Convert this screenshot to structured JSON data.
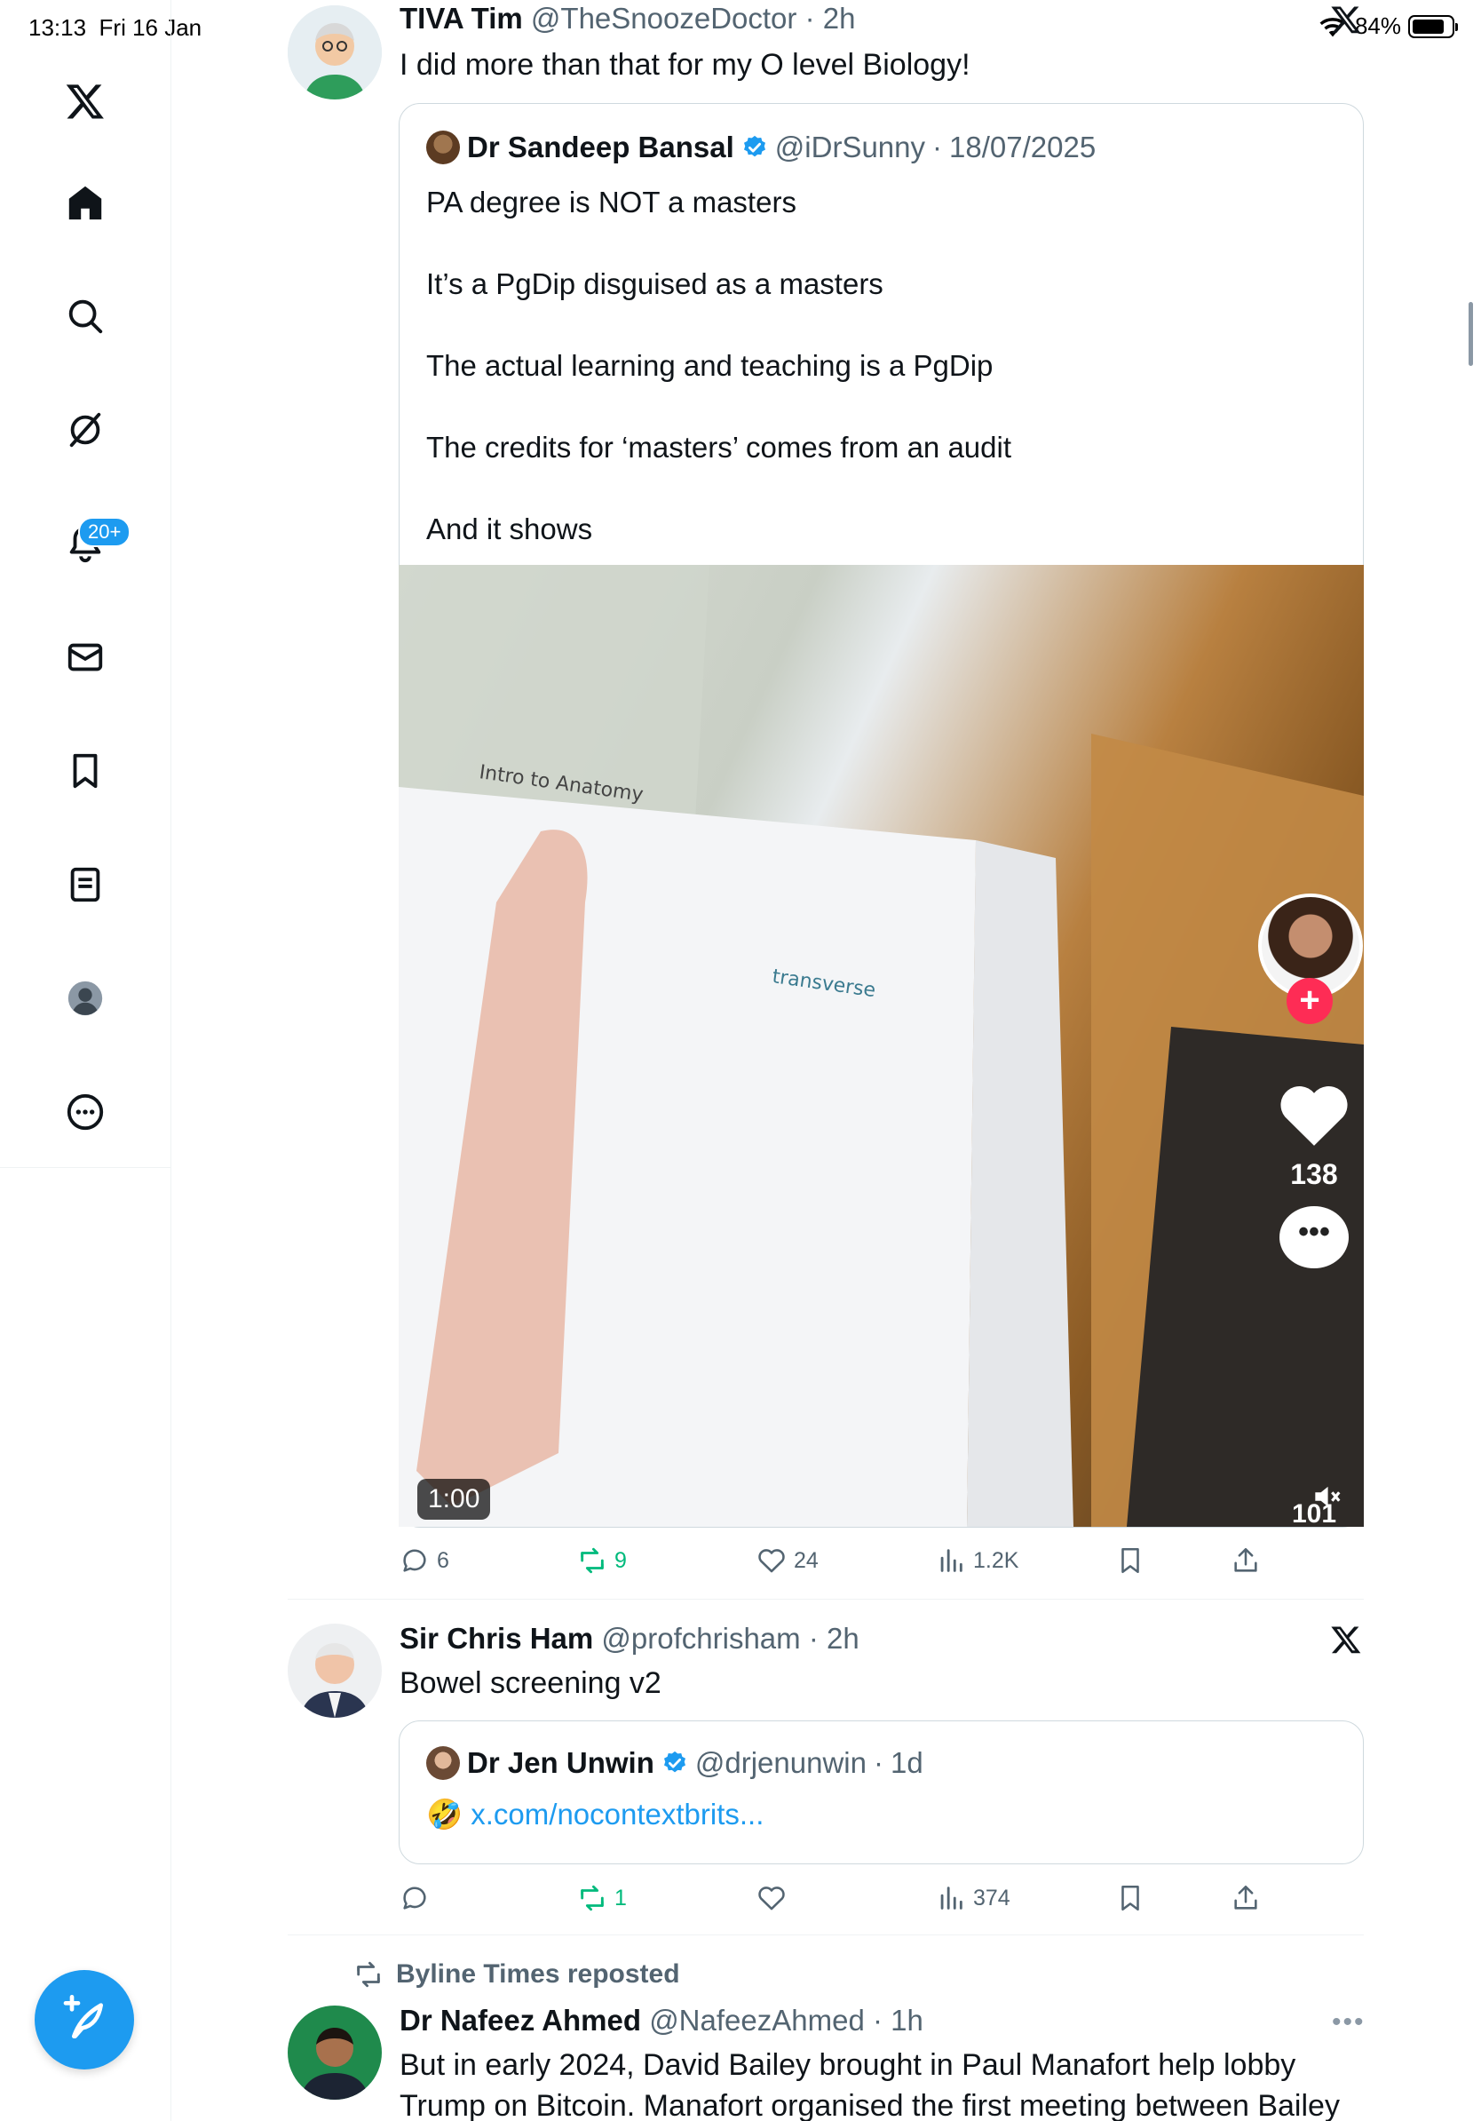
{
  "status": {
    "time": "13:13",
    "date": "Fri 16 Jan",
    "battery": "84%",
    "battery_level": 0.84
  },
  "sidebar": {
    "notifications_badge": "20+"
  },
  "tweets": [
    {
      "name": "TIVA Tim",
      "handle": "@TheSnoozeDoctor",
      "time": "2h",
      "text": "I did more than that for my O level Biology!",
      "quote": {
        "name": "Dr Sandeep Bansal",
        "handle": "@iDrSunny",
        "time": "18/07/2025",
        "lines": [
          "PA degree is NOT a masters",
          "It’s a PgDip disguised as a masters",
          "The actual learning and teaching is a PgDip",
          "The credits for ‘masters’ comes from an audit",
          "And it shows"
        ],
        "video": {
          "duration": "1:00",
          "likes": "138",
          "comments": "101"
        }
      },
      "stats": {
        "replies": "6",
        "reposts": "9",
        "likes": "24",
        "views": "1.2K"
      }
    },
    {
      "name": "Sir Chris Ham",
      "handle": "@profchrisham",
      "time": "2h",
      "text": "Bowel screening v2",
      "quote": {
        "name": "Dr Jen Unwin",
        "handle": "@drjenunwin",
        "time": "1d",
        "emoji": "🤣",
        "link": "x.com/nocontextbrits..."
      },
      "stats": {
        "replies": "",
        "reposts": "1",
        "likes": "",
        "views": "374"
      }
    },
    {
      "repost_label": "Byline Times reposted",
      "name": "Dr Nafeez Ahmed",
      "handle": "@NafeezAhmed",
      "time": "1h",
      "line1": "But in early 2024, David Bailey brought in Paul Manafort help lobby",
      "line2": "Trump on Bitcoin. Manafort organised the first meeting between Bailey"
    }
  ],
  "colors": {
    "accent": "#1d9bf0",
    "repost_green": "#00ba7c",
    "secondary_text": "#536471"
  }
}
